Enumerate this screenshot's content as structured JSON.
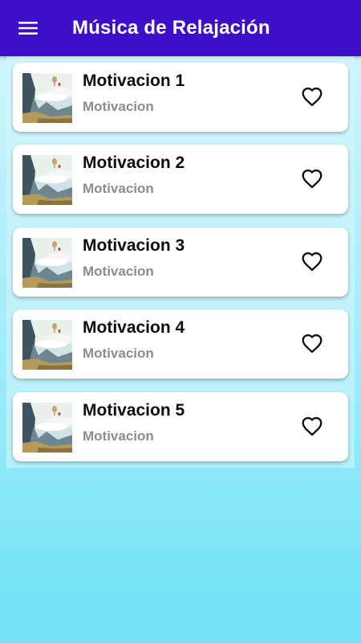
{
  "app_bar": {
    "title": "Música de Relajación",
    "background": "#3d0fc9",
    "menu_icon": "hamburger-menu-icon"
  },
  "tracks": [
    {
      "title": "Motivacion 1",
      "subtitle": "Motivacion",
      "favorite_icon": "heart-outline-icon"
    },
    {
      "title": "Motivacion 2",
      "subtitle": "Motivacion",
      "favorite_icon": "heart-outline-icon"
    },
    {
      "title": "Motivacion 3",
      "subtitle": "Motivacion",
      "favorite_icon": "heart-outline-icon"
    },
    {
      "title": "Motivacion 4",
      "subtitle": "Motivacion",
      "favorite_icon": "heart-outline-icon"
    },
    {
      "title": "Motivacion 5",
      "subtitle": "Motivacion",
      "favorite_icon": "heart-outline-icon"
    }
  ],
  "colors": {
    "card_background": "#ffffff",
    "title_text": "#0d0d0d",
    "subtitle_text": "#8c8c8c",
    "background_top": "#d7f6fd",
    "background_bottom": "#6fe2f7"
  }
}
